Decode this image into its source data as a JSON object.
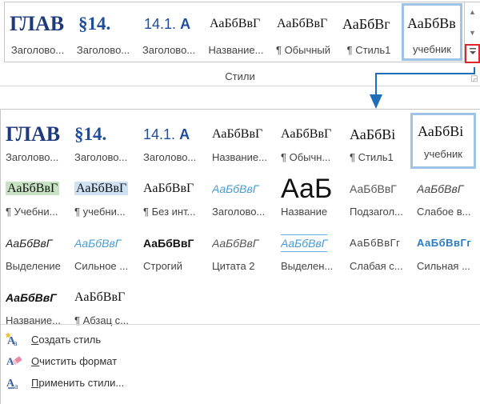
{
  "ribbon": {
    "group_label": "Стили",
    "tiles": [
      {
        "preview": "ГЛАВ",
        "label": "Заголово..."
      },
      {
        "preview": "§14.",
        "label": "Заголово..."
      },
      {
        "preview": "14.1.",
        "preview_bold": "А",
        "label": "Заголово..."
      },
      {
        "preview": "АаБбВвГ",
        "label": "Название..."
      },
      {
        "preview": "АаБбВвГ",
        "label": "¶ Обычный"
      },
      {
        "preview": "АаБбВг",
        "label": "¶ Стиль1"
      },
      {
        "preview": "АаБбВв",
        "label": "учебник"
      }
    ],
    "scroll_up_icon": "triangle-up",
    "scroll_down_icon": "triangle-down",
    "more_icon": "more-dropdown"
  },
  "panel": {
    "rows": [
      [
        {
          "preview": "ГЛАВ",
          "label": "Заголово..."
        },
        {
          "preview": "§14.",
          "label": "Заголово..."
        },
        {
          "preview": "14.1.",
          "preview_bold": "А",
          "label": "Заголово..."
        },
        {
          "preview": "АаБбВвГ",
          "label": "Название..."
        },
        {
          "preview": "АаБбВвГ",
          "label": "¶ Обычн..."
        },
        {
          "preview": "АаБбВі",
          "label": "¶ Стиль1"
        },
        {
          "preview": "АаБбВі",
          "label": "учебник"
        }
      ],
      [
        {
          "preview": "АаБбВвГ",
          "label": "¶ Учебни..."
        },
        {
          "preview": "АаБбВвГ",
          "label": "¶ учебни..."
        },
        {
          "preview": "АаБбВвГ",
          "label": "¶ Без инт..."
        },
        {
          "preview": "АаБбВвГ",
          "label": "Заголово..."
        },
        {
          "preview": "АаБ",
          "label": "Название"
        },
        {
          "preview": "АаБбВвГ",
          "label": "Подзагол..."
        },
        {
          "preview": "АаБбВвГ",
          "label": "Слабое в..."
        }
      ],
      [
        {
          "preview": "АаБбВвГ",
          "label": "Выделение"
        },
        {
          "preview": "АаБбВвГ",
          "label": "Сильное ..."
        },
        {
          "preview": "АаБбВвГ",
          "label": "Строгий"
        },
        {
          "preview": "АаБбВвГ",
          "label": "Цитата 2"
        },
        {
          "preview": "АаБбВвГ",
          "label": "Выделен..."
        },
        {
          "preview": "АаБбВвГг",
          "label": "Слабая с..."
        },
        {
          "preview": "АаБбВвГг",
          "label": "Сильная ..."
        }
      ],
      [
        {
          "preview": "АаБбВвГ",
          "label": "Название..."
        },
        {
          "preview": "АаБбВвГ",
          "label": "¶ Абзац с..."
        }
      ]
    ],
    "commands": [
      {
        "pre": "",
        "ul": "С",
        "post": "оздать стиль",
        "icon": "create-style-icon"
      },
      {
        "pre": "",
        "ul": "О",
        "post": "чистить формат",
        "icon": "clear-format-icon"
      },
      {
        "pre": "",
        "ul": "П",
        "post": "рименить стили...",
        "icon": "apply-styles-icon"
      }
    ]
  },
  "colors": {
    "selected_border": "#9fc3e6",
    "highlight_border": "#e1262a",
    "arrow": "#1f6fb8",
    "heading_blue": "#1f3a7a",
    "accent_blue": "#4a9bd1"
  }
}
